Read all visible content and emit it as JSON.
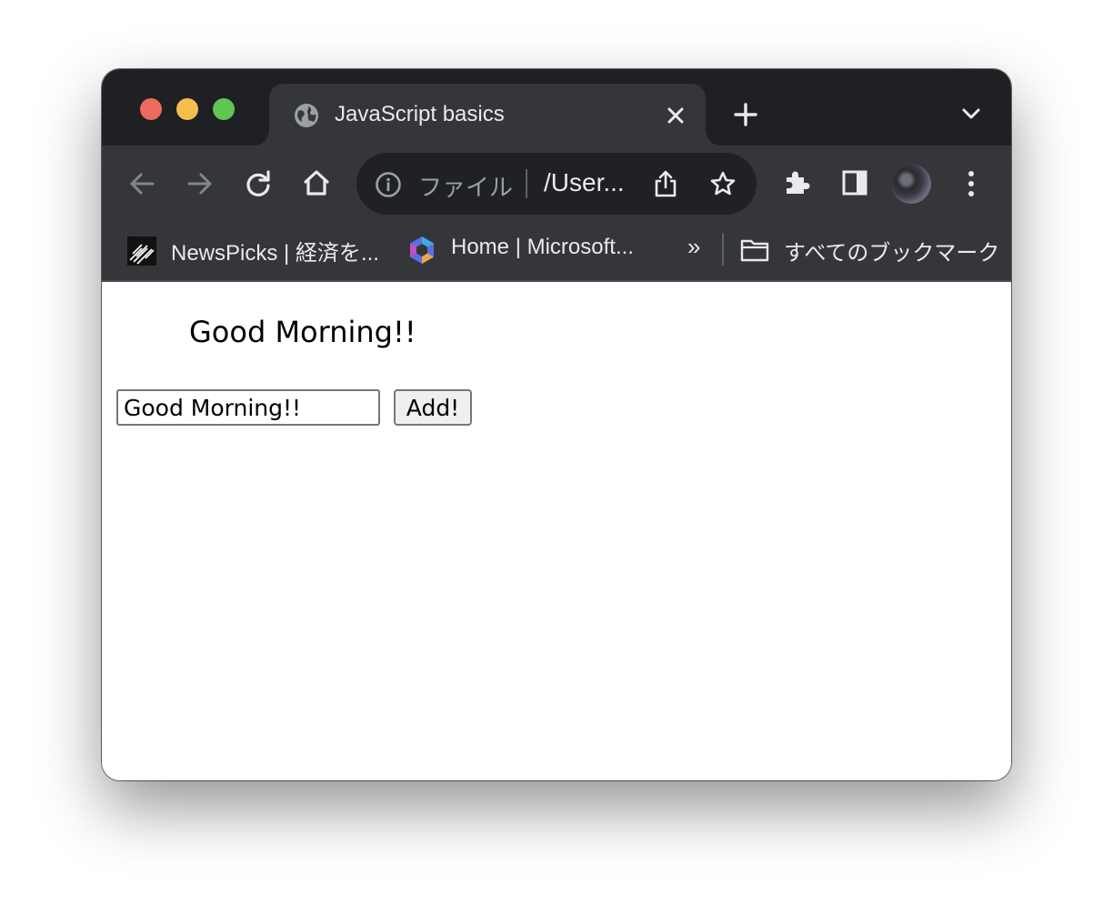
{
  "browser": {
    "tab": {
      "title": "JavaScript basics",
      "favicon": "globe-icon"
    },
    "omnibox": {
      "scheme_label": "ファイル",
      "url": "/User..."
    },
    "bookmarks": [
      {
        "label": "NewsPicks | 経済を...",
        "icon": "newspicks-favicon"
      },
      {
        "label": "Home | Microsoft...",
        "icon": "microsoft365-favicon"
      }
    ],
    "bookmarks_overflow": "»",
    "all_bookmarks_label": "すべてのブックマーク"
  },
  "page": {
    "greeting": "Good Morning!!",
    "input_value": "Good Morning!!",
    "add_button_label": "Add!"
  },
  "colors": {
    "tabstrip_bg": "#1f2023",
    "toolbar_bg": "#35363a",
    "omnibox_bg": "#202124",
    "traffic_red": "#ed6a5e",
    "traffic_yellow": "#f5bf4f",
    "traffic_green": "#61c554"
  }
}
